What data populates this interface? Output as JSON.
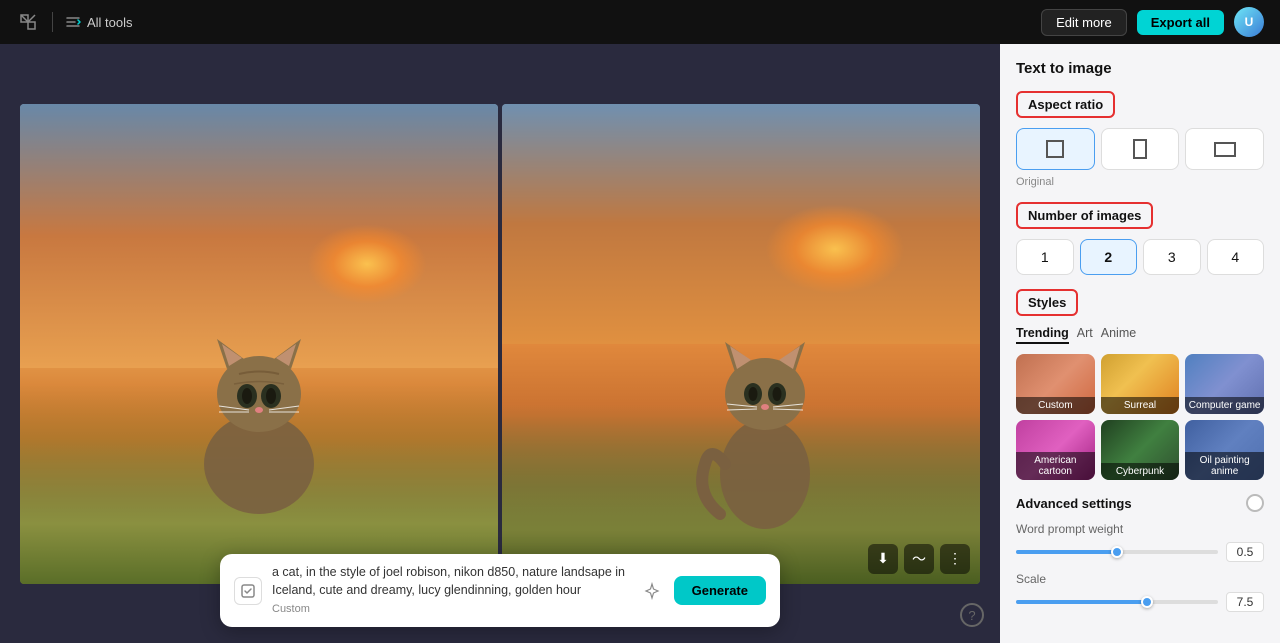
{
  "topbar": {
    "all_tools_label": "All tools",
    "edit_more_label": "Edit more",
    "export_all_label": "Export all"
  },
  "prompt_bar": {
    "text": "a cat, in the style of joel robison, nikon d850, nature landsape in Iceland, cute and dreamy, lucy glendinning, golden hour",
    "tag": "Custom",
    "generate_label": "Generate"
  },
  "right_panel": {
    "title": "Text to image",
    "aspect_ratio_label": "Aspect ratio",
    "original_label": "Original",
    "number_of_images_label": "Number of images",
    "styles_label": "Styles",
    "style_tabs": [
      {
        "label": "Trending",
        "active": true
      },
      {
        "label": "Art",
        "active": false
      },
      {
        "label": "Anime",
        "active": false
      }
    ],
    "style_items": [
      {
        "name": "Custom",
        "thumb_class": "thumb-custom"
      },
      {
        "name": "Surreal",
        "thumb_class": "thumb-surreal"
      },
      {
        "name": "Computer game",
        "thumb_class": "thumb-computer-game"
      },
      {
        "name": "American cartoon",
        "thumb_class": "thumb-american-cartoon"
      },
      {
        "name": "Cyberpunk",
        "thumb_class": "thumb-cyberpunk"
      },
      {
        "name": "Oil painting anime",
        "thumb_class": "thumb-oil-painting"
      }
    ],
    "num_buttons": [
      "1",
      "2",
      "3",
      "4"
    ],
    "active_num": "2",
    "advanced_settings_label": "Advanced settings",
    "word_prompt_weight_label": "Word prompt weight",
    "word_prompt_weight_value": "0.5",
    "scale_label": "Scale",
    "scale_value": "7.5",
    "word_prompt_fill_pct": 50,
    "scale_fill_pct": 65
  }
}
